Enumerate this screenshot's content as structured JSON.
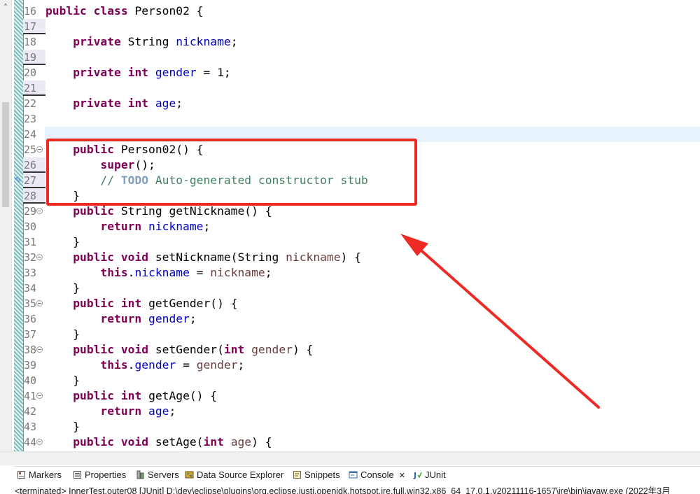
{
  "editor": {
    "line_numbers": [
      "16",
      "17",
      "18",
      "19",
      "20",
      "21",
      "22",
      "23",
      "24",
      "25",
      "26",
      "27",
      "28",
      "29",
      "30",
      "31",
      "32",
      "33",
      "34",
      "35",
      "36",
      "37",
      "38",
      "39",
      "40",
      "41",
      "42",
      "43",
      "44"
    ],
    "lines": [
      [
        [
          "kw",
          "public "
        ],
        [
          "kw",
          "class "
        ],
        [
          "",
          "Person02 {"
        ]
      ],
      [],
      [
        [
          "",
          "    "
        ],
        [
          "kw",
          "private "
        ],
        [
          "",
          "String "
        ],
        [
          "fld",
          "nickname"
        ],
        [
          "",
          ";"
        ]
      ],
      [],
      [
        [
          "",
          "    "
        ],
        [
          "kw",
          "private "
        ],
        [
          "kw",
          "int "
        ],
        [
          "fld",
          "gender"
        ],
        [
          "",
          " = 1;"
        ]
      ],
      [],
      [
        [
          "",
          "    "
        ],
        [
          "kw",
          "private "
        ],
        [
          "kw",
          "int "
        ],
        [
          "fld",
          "age"
        ],
        [
          "",
          ";"
        ]
      ],
      [],
      [],
      [
        [
          "",
          "    "
        ],
        [
          "kw",
          "public "
        ],
        [
          "",
          "Person02() {"
        ]
      ],
      [
        [
          "",
          "        "
        ],
        [
          "kw",
          "super"
        ],
        [
          "",
          "();"
        ]
      ],
      [
        [
          "",
          "        "
        ],
        [
          "cm",
          "// "
        ],
        [
          "todo",
          "TODO"
        ],
        [
          "cm",
          " Auto-generated constructor stub"
        ]
      ],
      [
        [
          "",
          "    }"
        ]
      ],
      [
        [
          "",
          "    "
        ],
        [
          "kw",
          "public "
        ],
        [
          "",
          "String getNickname() {"
        ]
      ],
      [
        [
          "",
          "        "
        ],
        [
          "kw",
          "return "
        ],
        [
          "fld",
          "nickname"
        ],
        [
          "",
          ";"
        ]
      ],
      [
        [
          "",
          "    }"
        ]
      ],
      [
        [
          "",
          "    "
        ],
        [
          "kw",
          "public "
        ],
        [
          "kw",
          "void "
        ],
        [
          "",
          "setNickname(String "
        ],
        [
          "par",
          "nickname"
        ],
        [
          "",
          ") {"
        ]
      ],
      [
        [
          "",
          "        "
        ],
        [
          "kw",
          "this"
        ],
        [
          "",
          "."
        ],
        [
          "fld",
          "nickname"
        ],
        [
          "",
          " = "
        ],
        [
          "par",
          "nickname"
        ],
        [
          "",
          ";"
        ]
      ],
      [
        [
          "",
          "    }"
        ]
      ],
      [
        [
          "",
          "    "
        ],
        [
          "kw",
          "public "
        ],
        [
          "kw",
          "int "
        ],
        [
          "",
          "getGender() {"
        ]
      ],
      [
        [
          "",
          "        "
        ],
        [
          "kw",
          "return "
        ],
        [
          "fld",
          "gender"
        ],
        [
          "",
          ";"
        ]
      ],
      [
        [
          "",
          "    }"
        ]
      ],
      [
        [
          "",
          "    "
        ],
        [
          "kw",
          "public "
        ],
        [
          "kw",
          "void "
        ],
        [
          "",
          "setGender("
        ],
        [
          "kw",
          "int "
        ],
        [
          "par",
          "gender"
        ],
        [
          "",
          ") {"
        ]
      ],
      [
        [
          "",
          "        "
        ],
        [
          "kw",
          "this"
        ],
        [
          "",
          "."
        ],
        [
          "fld",
          "gender"
        ],
        [
          "",
          " = "
        ],
        [
          "par",
          "gender"
        ],
        [
          "",
          ";"
        ]
      ],
      [
        [
          "",
          "    }"
        ]
      ],
      [
        [
          "",
          "    "
        ],
        [
          "kw",
          "public "
        ],
        [
          "kw",
          "int "
        ],
        [
          "",
          "getAge() {"
        ]
      ],
      [
        [
          "",
          "        "
        ],
        [
          "kw",
          "return "
        ],
        [
          "fld",
          "age"
        ],
        [
          "",
          ";"
        ]
      ],
      [
        [
          "",
          "    }"
        ]
      ],
      [
        [
          "",
          "    "
        ],
        [
          "kw",
          "public "
        ],
        [
          "kw",
          "void "
        ],
        [
          "",
          "setAge("
        ],
        [
          "kw",
          "int "
        ],
        [
          "par",
          "age"
        ],
        [
          "",
          ") {"
        ]
      ]
    ]
  },
  "panel_tabs": [
    {
      "label": "Markers",
      "icon": "markers-icon"
    },
    {
      "label": "Properties",
      "icon": "properties-icon"
    },
    {
      "label": "Servers",
      "icon": "servers-icon"
    },
    {
      "label": "Data Source Explorer",
      "icon": "data-source-explorer-icon"
    },
    {
      "label": "Snippets",
      "icon": "snippets-icon"
    },
    {
      "label": "Console",
      "icon": "console-icon",
      "close": "✕"
    },
    {
      "label": "JUnit",
      "icon": "junit-icon"
    }
  ],
  "console_status": "<terminated> InnerTest.outer08 [JUnit] D:\\dev\\eclipse\\plugins\\org.eclipse.justj.openjdk.hotspot.jre.full.win32.x86_64_17.0.1.v20211116-1657\\jre\\bin\\javaw.exe  (2022年3月",
  "colors": {
    "annotation": "#ee2a24",
    "keyword": "#7f0055",
    "field": "#0000c0",
    "comment": "#3f7f5f"
  }
}
